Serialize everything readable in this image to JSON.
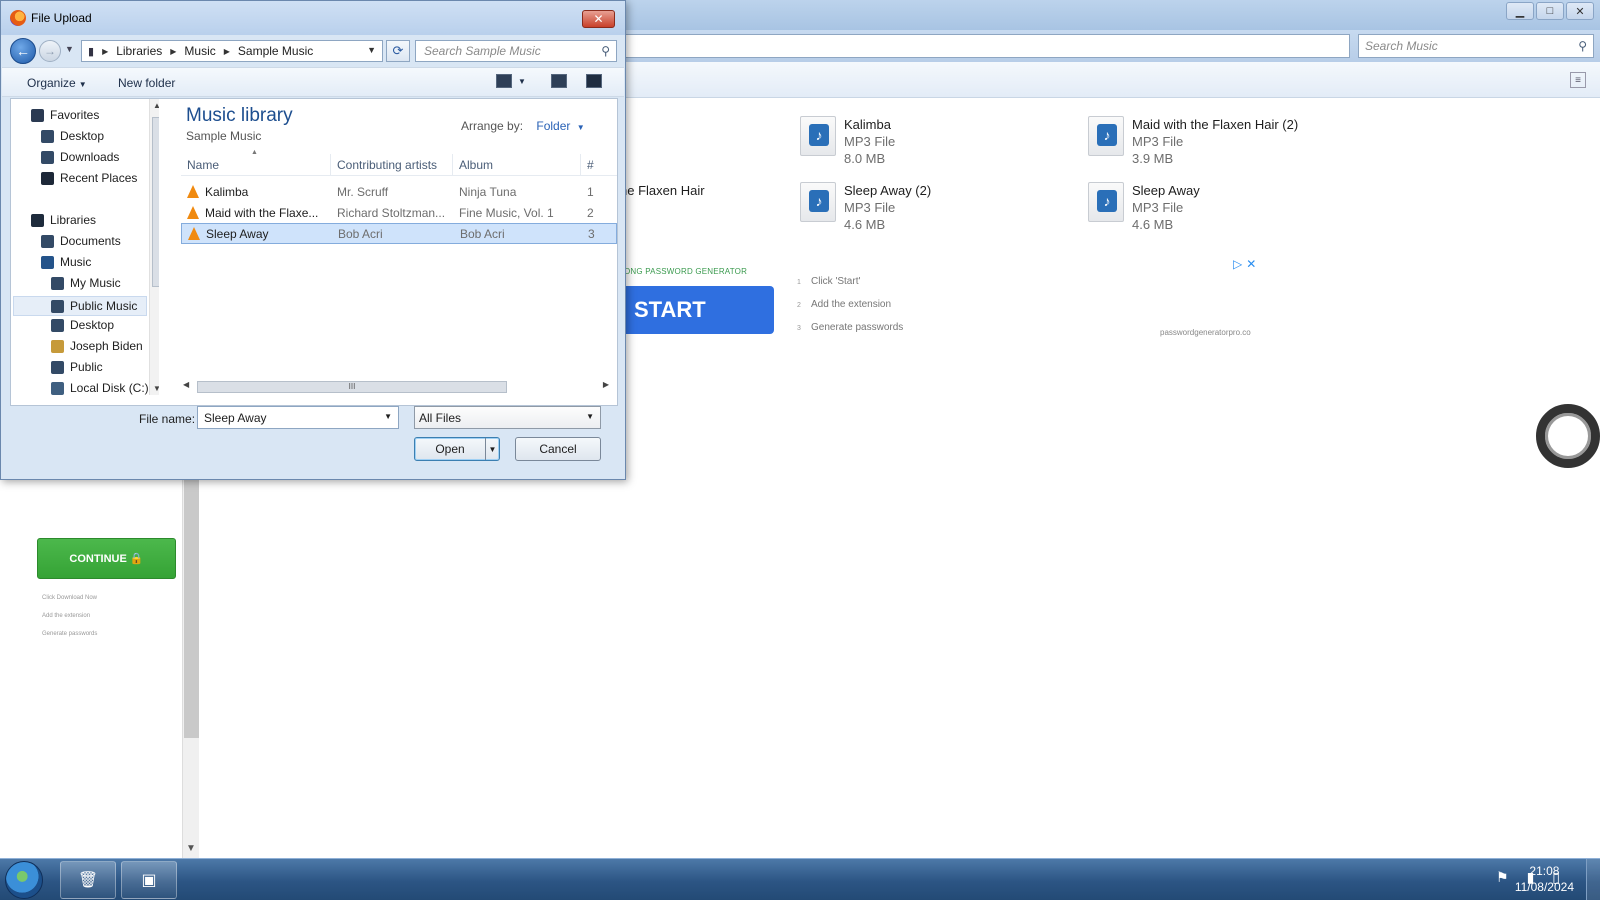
{
  "background": {
    "search_placeholder": "Search Music",
    "files": [
      {
        "name": "Kalimba",
        "type": "MP3 File",
        "size": "8.0 MB"
      },
      {
        "name": "Maid with the Flaxen Hair (2)",
        "type": "MP3 File",
        "size": "3.9 MB"
      },
      {
        "name": "Sleep Away (2)",
        "type": "MP3 File",
        "size": "4.6 MB"
      },
      {
        "name": "Sleep Away",
        "type": "MP3 File",
        "size": "4.6 MB"
      }
    ],
    "partial_file_name": "ne Flaxen Hair"
  },
  "ad": {
    "label": "ONG PASSWORD GENERATOR",
    "start_label": "START",
    "steps": [
      "Click 'Start'",
      "Add the extension",
      "Generate passwords"
    ],
    "step_numbers": [
      "1",
      "2",
      "3"
    ],
    "domain": "passwordgeneratorpro.co",
    "continue_label": "CONTINUE 🔒",
    "left_steps": [
      "Click Download Now",
      "Add the extension",
      "Generate passwords"
    ]
  },
  "dialog": {
    "title": "File Upload",
    "close_glyph": "✕",
    "breadcrumb": [
      "Libraries",
      "Music",
      "Sample Music"
    ],
    "search_placeholder": "Search Sample Music",
    "toolbar": {
      "organize": "Organize",
      "new_folder": "New folder"
    },
    "nav": {
      "favorites": "Favorites",
      "desktop": "Desktop",
      "downloads": "Downloads",
      "recent_places": "Recent Places",
      "libraries": "Libraries",
      "documents": "Documents",
      "music": "Music",
      "my_music": "My Music",
      "public_music": "Public Music",
      "desktop2": "Desktop",
      "joseph_biden": "Joseph Biden",
      "public": "Public",
      "local_disk": "Local Disk (C:)"
    },
    "library_title": "Music library",
    "library_subtitle": "Sample Music",
    "arrange_label": "Arrange by:",
    "arrange_value": "Folder",
    "columns": [
      "Name",
      "Contributing artists",
      "Album",
      "#"
    ],
    "rows": [
      {
        "name": "Kalimba",
        "artist": "Mr. Scruff",
        "album": "Ninja Tuna",
        "num": "1"
      },
      {
        "name": "Maid with the Flaxe...",
        "artist": "Richard Stoltzman...",
        "album": "Fine Music, Vol. 1",
        "num": "2"
      },
      {
        "name": "Sleep Away",
        "artist": "Bob Acri",
        "album": "Bob Acri",
        "num": "3"
      }
    ],
    "selected_row_index": 2,
    "hscroll_grip": "III",
    "file_name_label": "File name:",
    "file_name_value": "Sleep Away",
    "file_type_value": "All Files",
    "open_label": "Open",
    "cancel_label": "Cancel"
  },
  "taskbar": {
    "time": "21:08",
    "date": "11/08/2024"
  }
}
